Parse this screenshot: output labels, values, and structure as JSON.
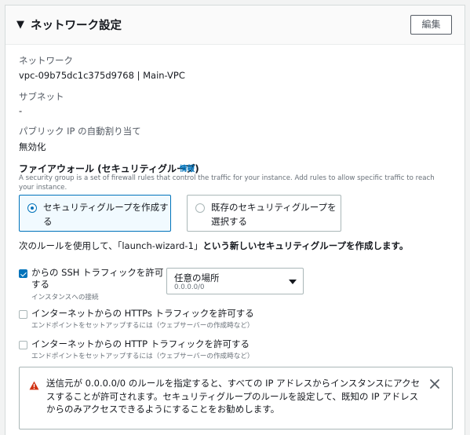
{
  "header": {
    "title": "ネットワーク設定",
    "edit_label": "編集"
  },
  "network": {
    "label": "ネットワーク",
    "value": "vpc-09b75dc1c375d9768 | Main-VPC"
  },
  "subnet": {
    "label": "サブネット",
    "value": "-"
  },
  "public_ip": {
    "label": "パブリック IP の自動割り当て",
    "value": "無効化"
  },
  "firewall": {
    "title": "ファイアウォール (セキュリティグループ)",
    "info": "情報",
    "description": "A security group is a set of firewall rules that control the traffic for your instance. Add rules to allow specific traffic to reach your instance.",
    "options": [
      {
        "label_line1": "セキュリティグループを作成す",
        "label_line2": "る",
        "selected": true
      },
      {
        "label_line1": "既存のセキュリティグループを",
        "label_line2": "選択する",
        "selected": false
      }
    ],
    "rule_prefix": "次のルールを使用して、「launch-wizard-1」",
    "rule_bold": "という新しいセキュリティグループを作成します。"
  },
  "rules": [
    {
      "label_line1": "からの SSH トラフィックを許可",
      "label_line2": "する",
      "sub": "インスタンスへの接続",
      "checked": true
    },
    {
      "label": "インターネットからの HTTPs トラフィックを許可する",
      "sub": "エンドポイントをセットアップするには（ウェブサーバーの作成時など）",
      "checked": false
    },
    {
      "label": "インターネットからの HTTP トラフィックを許可する",
      "sub": "エンドポイントをセットアップするには（ウェブサーバーの作成時など）",
      "checked": false
    }
  ],
  "source_select": {
    "value": "任意の場所",
    "sub": "0.0.0.0/0"
  },
  "warning": {
    "text": "送信元が 0.0.0.0/0 のルールを指定すると、すべての IP アドレスからインスタンスにアクセスすることが許可されます。セキュリティグループのルールを設定して、既知の IP アドレスからのみアクセスできるようにすることをお勧めします。",
    "icon": "warning-icon"
  },
  "colors": {
    "accent": "#0073bb",
    "warning": "#d13212",
    "border": "#aab7b8"
  }
}
